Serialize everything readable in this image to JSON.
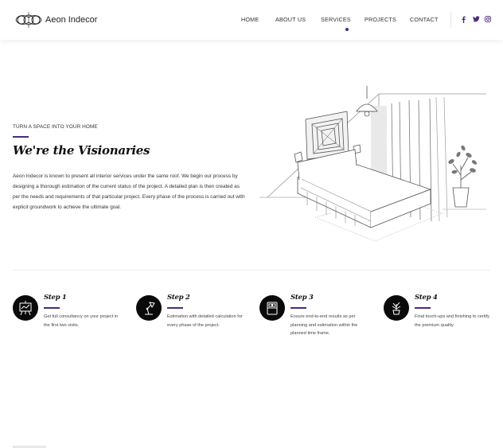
{
  "brand": {
    "name": "Aeon Indecor"
  },
  "nav": {
    "items": [
      {
        "label": "HOME",
        "active": false
      },
      {
        "label": "ABOUT US",
        "active": false
      },
      {
        "label": "SERVICES",
        "active": true
      },
      {
        "label": "PROJECTS",
        "active": false
      },
      {
        "label": "CONTACT",
        "active": false
      }
    ],
    "social": [
      "f",
      "y",
      "ig"
    ]
  },
  "hero": {
    "eyebrow": "TURN A SPACE INTO YOUR HOME",
    "title": "We're the Visionaries",
    "text": "Aeon Indecor is known to present all interior services under the same roof. We begin our process by designing a thorough estimation of the current status of the project. A detailed plan is then created as per the needs and requirements of that particular project. Every phase of the process is carried out with explicit groundwork to achieve the ultimate goal."
  },
  "steps": [
    {
      "title": "Step 1",
      "desc": "Get full consultancy on your project in the first two visits.",
      "icon": "presentation-board-icon"
    },
    {
      "title": "Step 2",
      "desc": "Estimation with detailed calculation for every phase of the project.",
      "icon": "desk-lamp-icon"
    },
    {
      "title": "Step 3",
      "desc": "Ensure end-to-end results as per planning and estimation within the planned time frame.",
      "icon": "bed-icon"
    },
    {
      "title": "Step 4",
      "desc": "Final touch-ups and finishing to certify the premium quality",
      "icon": "plant-pot-icon"
    }
  ],
  "colors": {
    "accent": "#4b2a7b",
    "icon_bg": "#0a0a0a"
  }
}
